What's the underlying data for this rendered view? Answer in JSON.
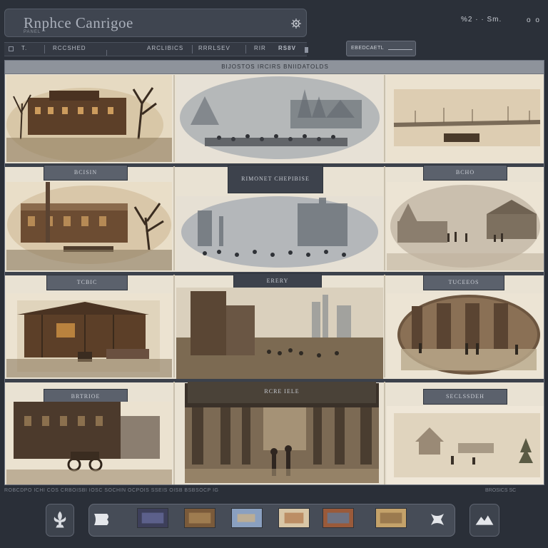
{
  "app": {
    "title": "Rnphce Canrigoe",
    "subtitle": "PANEL",
    "top_right_text": "%2 · · Sm.",
    "top_dots": "o o"
  },
  "toolbar": {
    "items": [
      "T.",
      "RCCSHED",
      "ARCLIBICS",
      "RRRLSEV",
      "RIR",
      "RS8V"
    ]
  },
  "dropdown": {
    "label": "EBEDCAETL"
  },
  "board": {
    "header": "BIJOSTOS IRCIRS BNIIDATOLDS",
    "labels": {
      "row1_left": "BCISIN",
      "row1_mid": "RIMONET CHEPIBISE",
      "row1_right": "BCHO",
      "row2_left": "TCBIC",
      "row2_mid": "ERERY",
      "row2_right": "TUCEEOS",
      "row3_left": "BRTRIOE",
      "row3_mid": "RCRE IELE",
      "row3_right": "SECLSSDEH"
    }
  },
  "status": {
    "left": "ROBCDPO ICHI COS CRBOISBI IOSC SOCHIN OCPOIS SSEIS OISB BSBSOCP IG",
    "right": "BROSICS SC"
  },
  "dock": {
    "thumbnails": 6
  },
  "colors": {
    "sepia_dark": "#3b2f24",
    "sepia_mid": "#7a6248",
    "sepia_light": "#d8c9ad",
    "fog": "#9aa1a8"
  }
}
